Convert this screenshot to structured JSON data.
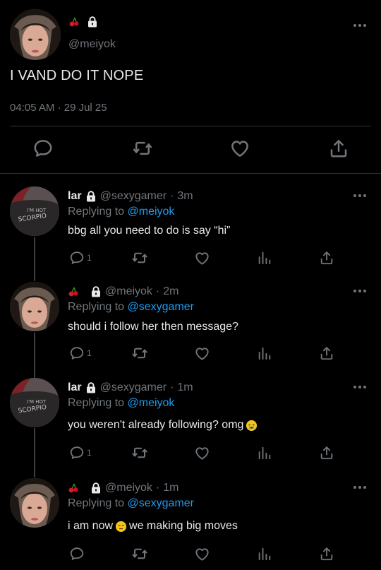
{
  "main_tweet": {
    "handle": "@meiyok",
    "text": "I VAND DO IT NOPE",
    "time": "04:05 AM",
    "separator": "·",
    "date": "29 Jul 25"
  },
  "replies": [
    {
      "name": "lar",
      "handle": "@sexygamer",
      "separator": "·",
      "time": "3m",
      "replying_prefix": "Replying to",
      "replying_to": "@meiyok",
      "text": "bbg all you need to do is say “hi”",
      "reply_count": "1"
    },
    {
      "name": "",
      "handle": "@meiyok",
      "separator": "·",
      "time": "2m",
      "replying_prefix": "Replying to",
      "replying_to": "@sexygamer",
      "text": "should i follow her then message?",
      "reply_count": "1"
    },
    {
      "name": "lar",
      "handle": "@sexygamer",
      "separator": "·",
      "time": "1m",
      "replying_prefix": "Replying to",
      "replying_to": "@meiyok",
      "text": "you weren't already following? omg",
      "reply_count": "1"
    },
    {
      "name": "",
      "handle": "@meiyok",
      "separator": "·",
      "time": "1m",
      "replying_prefix": "Replying to",
      "replying_to": "@sexygamer",
      "text_before_emoji": "i am now",
      "text_after_emoji": "we making big moves",
      "reply_count": ""
    }
  ],
  "avatar_shirt_text": {
    "line1": "I'M HOT",
    "line2": "SCORPIO"
  },
  "icons": {
    "more": "more-horizontal-icon",
    "reply": "reply-bubble-icon",
    "retweet": "retweet-icon",
    "like": "heart-icon",
    "share": "share-icon",
    "views": "bar-chart-icon",
    "cherry": "cherry-icon",
    "lock": "lock-icon"
  },
  "colors": {
    "background": "#000000",
    "text": "#e7e9ea",
    "muted": "#71767b",
    "link": "#1d9bf0",
    "divider": "#2f3336"
  }
}
